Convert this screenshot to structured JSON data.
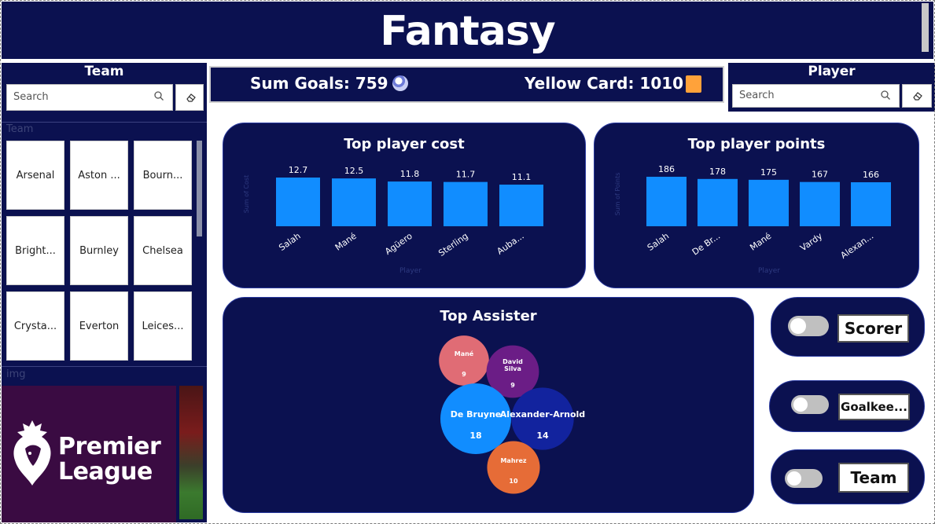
{
  "header": {
    "title": "Fantasy"
  },
  "team_slicer": {
    "title": "Team",
    "search_placeholder": "Search",
    "field_label": "Team",
    "teams": [
      "Arsenal",
      "Aston ...",
      "Bourn...",
      "Bright...",
      "Burnley",
      "Chelsea",
      "Crysta...",
      "Everton",
      "Leices..."
    ]
  },
  "image_section": {
    "label": "img",
    "logo_line1": "Premier",
    "logo_line2": "League"
  },
  "kpis": {
    "goals": "Sum Goals: 759",
    "goals_icon": "soccer-ball-icon",
    "yellow": "Yellow Card: 1010",
    "yellow_icon": "yellow-card-icon"
  },
  "player_slicer": {
    "title": "Player",
    "search_placeholder": "Search"
  },
  "chart_data": [
    {
      "type": "bar",
      "title": "Top player cost",
      "xlabel": "Player",
      "ylabel": "Sum of Cost",
      "categories": [
        "Salah",
        "Mané",
        "Agüero",
        "Sterling",
        "Auba..."
      ],
      "values": [
        12.7,
        12.5,
        11.8,
        11.7,
        11.1
      ],
      "labels": [
        "12.7",
        "12.5",
        "11.8",
        "11.7",
        "11.1"
      ],
      "color": "#118dff"
    },
    {
      "type": "bar",
      "title": "Top player points",
      "xlabel": "Player",
      "ylabel": "Sum of Points",
      "categories": [
        "Salah",
        "De Br...",
        "Mané",
        "Vardy",
        "Alexan..."
      ],
      "values": [
        186,
        178,
        175,
        167,
        166
      ],
      "labels": [
        "186",
        "178",
        "175",
        "167",
        "166"
      ],
      "color": "#118dff"
    },
    {
      "type": "scatter",
      "title": "Top Assister",
      "bubbles": [
        {
          "name": "Mané",
          "value": 9,
          "label": "9",
          "color": "#e06c75"
        },
        {
          "name": "David Silva",
          "value": 9,
          "label": "9",
          "color": "#6b1d86"
        },
        {
          "name": "De Bruyne",
          "value": 18,
          "label": "18",
          "color": "#118dff"
        },
        {
          "name": "Alexander-Arnold",
          "value": 14,
          "label": "14",
          "color": "#12239e"
        },
        {
          "name": "Mahrez",
          "value": 10,
          "label": "10",
          "color": "#e66c37"
        }
      ]
    }
  ],
  "toggles": [
    {
      "label": "Scorer"
    },
    {
      "label": "Goalkee..."
    },
    {
      "label": "Team"
    }
  ]
}
